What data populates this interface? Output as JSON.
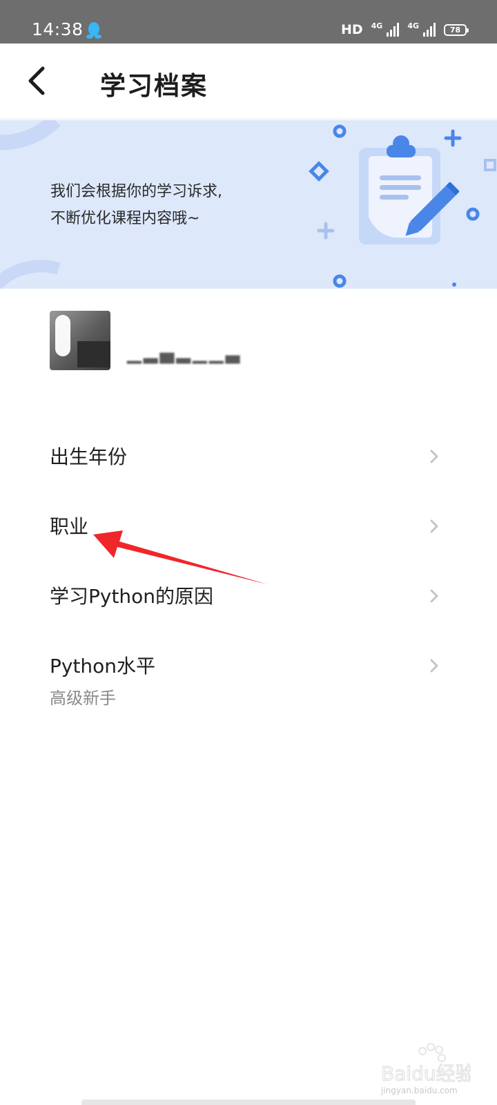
{
  "status_bar": {
    "time": "14:38",
    "hd": "HD",
    "network_1": "4G",
    "network_2": "4G",
    "battery": "78"
  },
  "header": {
    "title": "学习档案",
    "back_icon": "chevron-left-icon"
  },
  "banner": {
    "line1": "我们会根据你的学习诉求,",
    "line2": "不断优化课程内容哦~"
  },
  "list": [
    {
      "label": "出生年份",
      "sub": ""
    },
    {
      "label": "职业",
      "sub": ""
    },
    {
      "label": "学习Python的原因",
      "sub": ""
    },
    {
      "label": "Python水平",
      "sub": "高级新手"
    }
  ],
  "colors": {
    "banner_bg": "#dde8fb",
    "accent_blue": "#4a86e8",
    "arrow_red": "#f0262b"
  },
  "watermark": {
    "brand": "Baidu经验",
    "site": "jingyan.baidu.com"
  }
}
